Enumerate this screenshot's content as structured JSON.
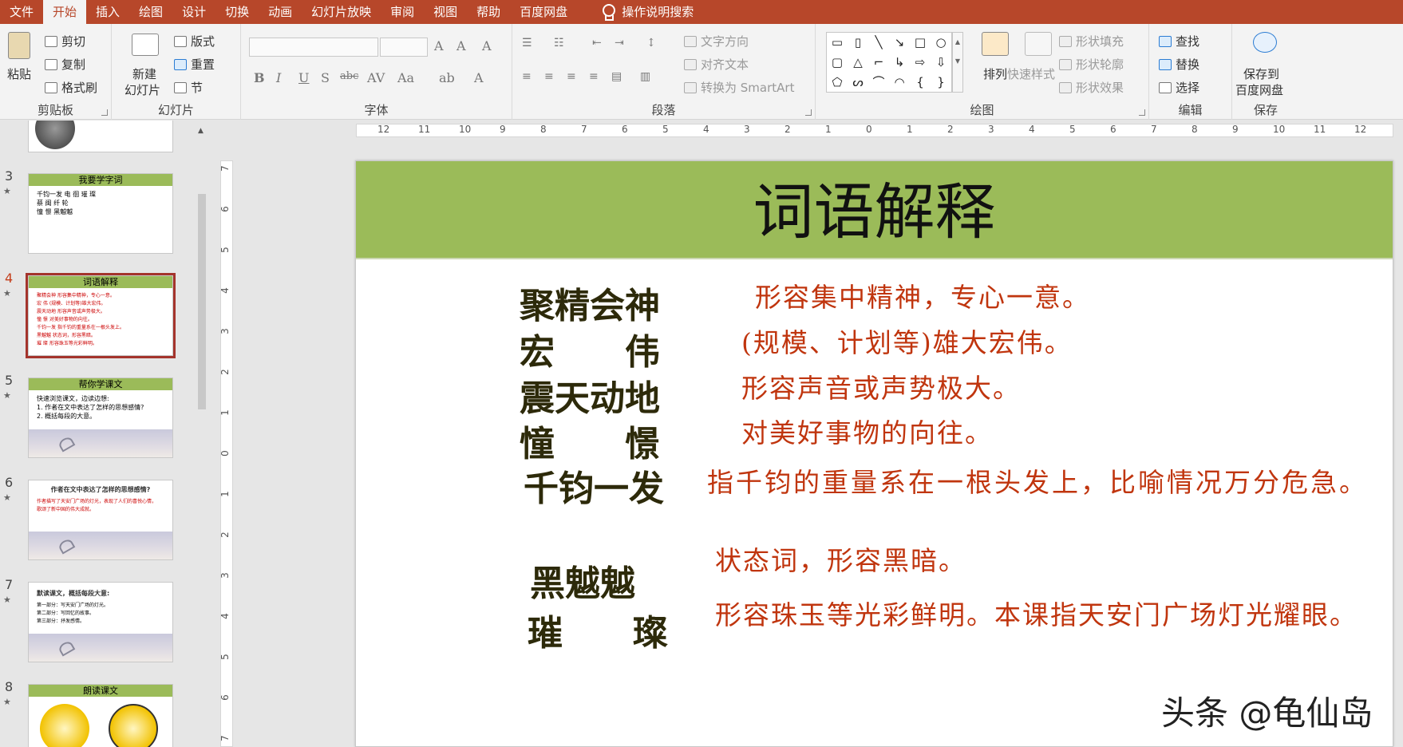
{
  "menu": {
    "tabs": [
      "文件",
      "开始",
      "插入",
      "绘图",
      "设计",
      "切换",
      "动画",
      "幻灯片放映",
      "审阅",
      "视图",
      "帮助",
      "百度网盘"
    ],
    "active_tab": "开始",
    "search": "操作说明搜索"
  },
  "ribbon": {
    "clipboard": {
      "label": "剪贴板",
      "paste": "粘贴",
      "cut": "剪切",
      "copy": "复制",
      "format_painter": "格式刷"
    },
    "slides": {
      "label": "幻灯片",
      "new_slide_1": "新建",
      "new_slide_2": "幻灯片",
      "layout": "版式",
      "reset": "重置",
      "section": "节"
    },
    "font": {
      "label": "字体"
    },
    "paragraph": {
      "label": "段落",
      "text_direction": "文字方向",
      "align_text": "对齐文本",
      "convert_smartart": "转换为 SmartArt"
    },
    "drawing": {
      "label": "绘图",
      "arrange": "排列",
      "quick_styles": "快速样式",
      "shape_fill": "形状填充",
      "shape_outline": "形状轮廓",
      "shape_effects": "形状效果"
    },
    "editing": {
      "label": "编辑",
      "find": "查找",
      "replace": "替换",
      "select": "选择"
    },
    "save": {
      "label": "保存",
      "save_1": "保存到",
      "save_2": "百度网盘"
    }
  },
  "thumbnails": [
    {
      "num": "3",
      "title": "我要学字词",
      "lines": [
        "千钧一发   电 徊   璀 璨",
        "蔡   闽 纤   轮",
        "憧 憬   黑魆魆"
      ]
    },
    {
      "num": "4",
      "title": "词语解释",
      "lines": [
        "聚精会神   形容集中精神，专心一意。",
        "宏   伟   (规模、计划等)雄大宏伟。",
        "震天动地   形容声音或声势极大。",
        "憧   憬   对美好事物的向往。",
        "千钧一发   指千钧的重量系在一根头发上。",
        "黑魆魆   状态词，形容黑暗。",
        "璀   璨   形容珠玉等光彩鲜明。"
      ]
    },
    {
      "num": "5",
      "title": "帮你学课文",
      "lines": [
        "快速浏览课文，边读边想:",
        "1. 作者在文中表达了怎样的思想感情?",
        "2. 概括每段的大意。"
      ]
    },
    {
      "num": "6",
      "title": "作者在文中表达了怎样的思想感情?",
      "lines": [
        "作者描写了天安门广场的灯光，表现了人们的喜悦心情，",
        "歌颂了新中国的伟大成就。"
      ]
    },
    {
      "num": "7",
      "title": "默读课文，概括每段大意:",
      "lines": [
        "第一部分：写天安门广场的灯光。",
        "第二部分：写回忆的故事。",
        "第三部分：抒发感情。"
      ]
    },
    {
      "num": "8",
      "title": "朗读课文",
      "lines": []
    }
  ],
  "ruler": {
    "h": [
      "12",
      "11",
      "10",
      "9",
      "8",
      "7",
      "6",
      "5",
      "4",
      "3",
      "2",
      "1",
      "0",
      "1",
      "2",
      "3",
      "4",
      "5",
      "6",
      "7",
      "8",
      "9",
      "10",
      "11",
      "12"
    ],
    "v": [
      "7",
      "6",
      "5",
      "4",
      "3",
      "2",
      "1",
      "0",
      "1",
      "2",
      "3",
      "4",
      "5",
      "6",
      "7"
    ]
  },
  "slide": {
    "title": "词语解释",
    "terms": [
      "聚精会神",
      "宏　　伟",
      "震天动地",
      "憧　　憬",
      "千钧一发",
      "黑魆魆",
      "璀　　璨"
    ],
    "definitions": [
      "形容集中精神，专心一意。",
      "(规模、计划等)雄大宏伟。",
      "形容声音或声势极大。",
      "对美好事物的向往。",
      "指千钧的重量系在一根头发上，比喻情况万分危急。",
      "状态词，形容黑暗。",
      "形容珠玉等光彩鲜明。本课指天安门广场灯光耀眼。"
    ]
  },
  "watermark": "头条 @龟仙岛",
  "colors": {
    "accent": "#b7472a",
    "banner": "#9bbb59",
    "definition": "#c0350e",
    "term": "#2d2a0a"
  }
}
